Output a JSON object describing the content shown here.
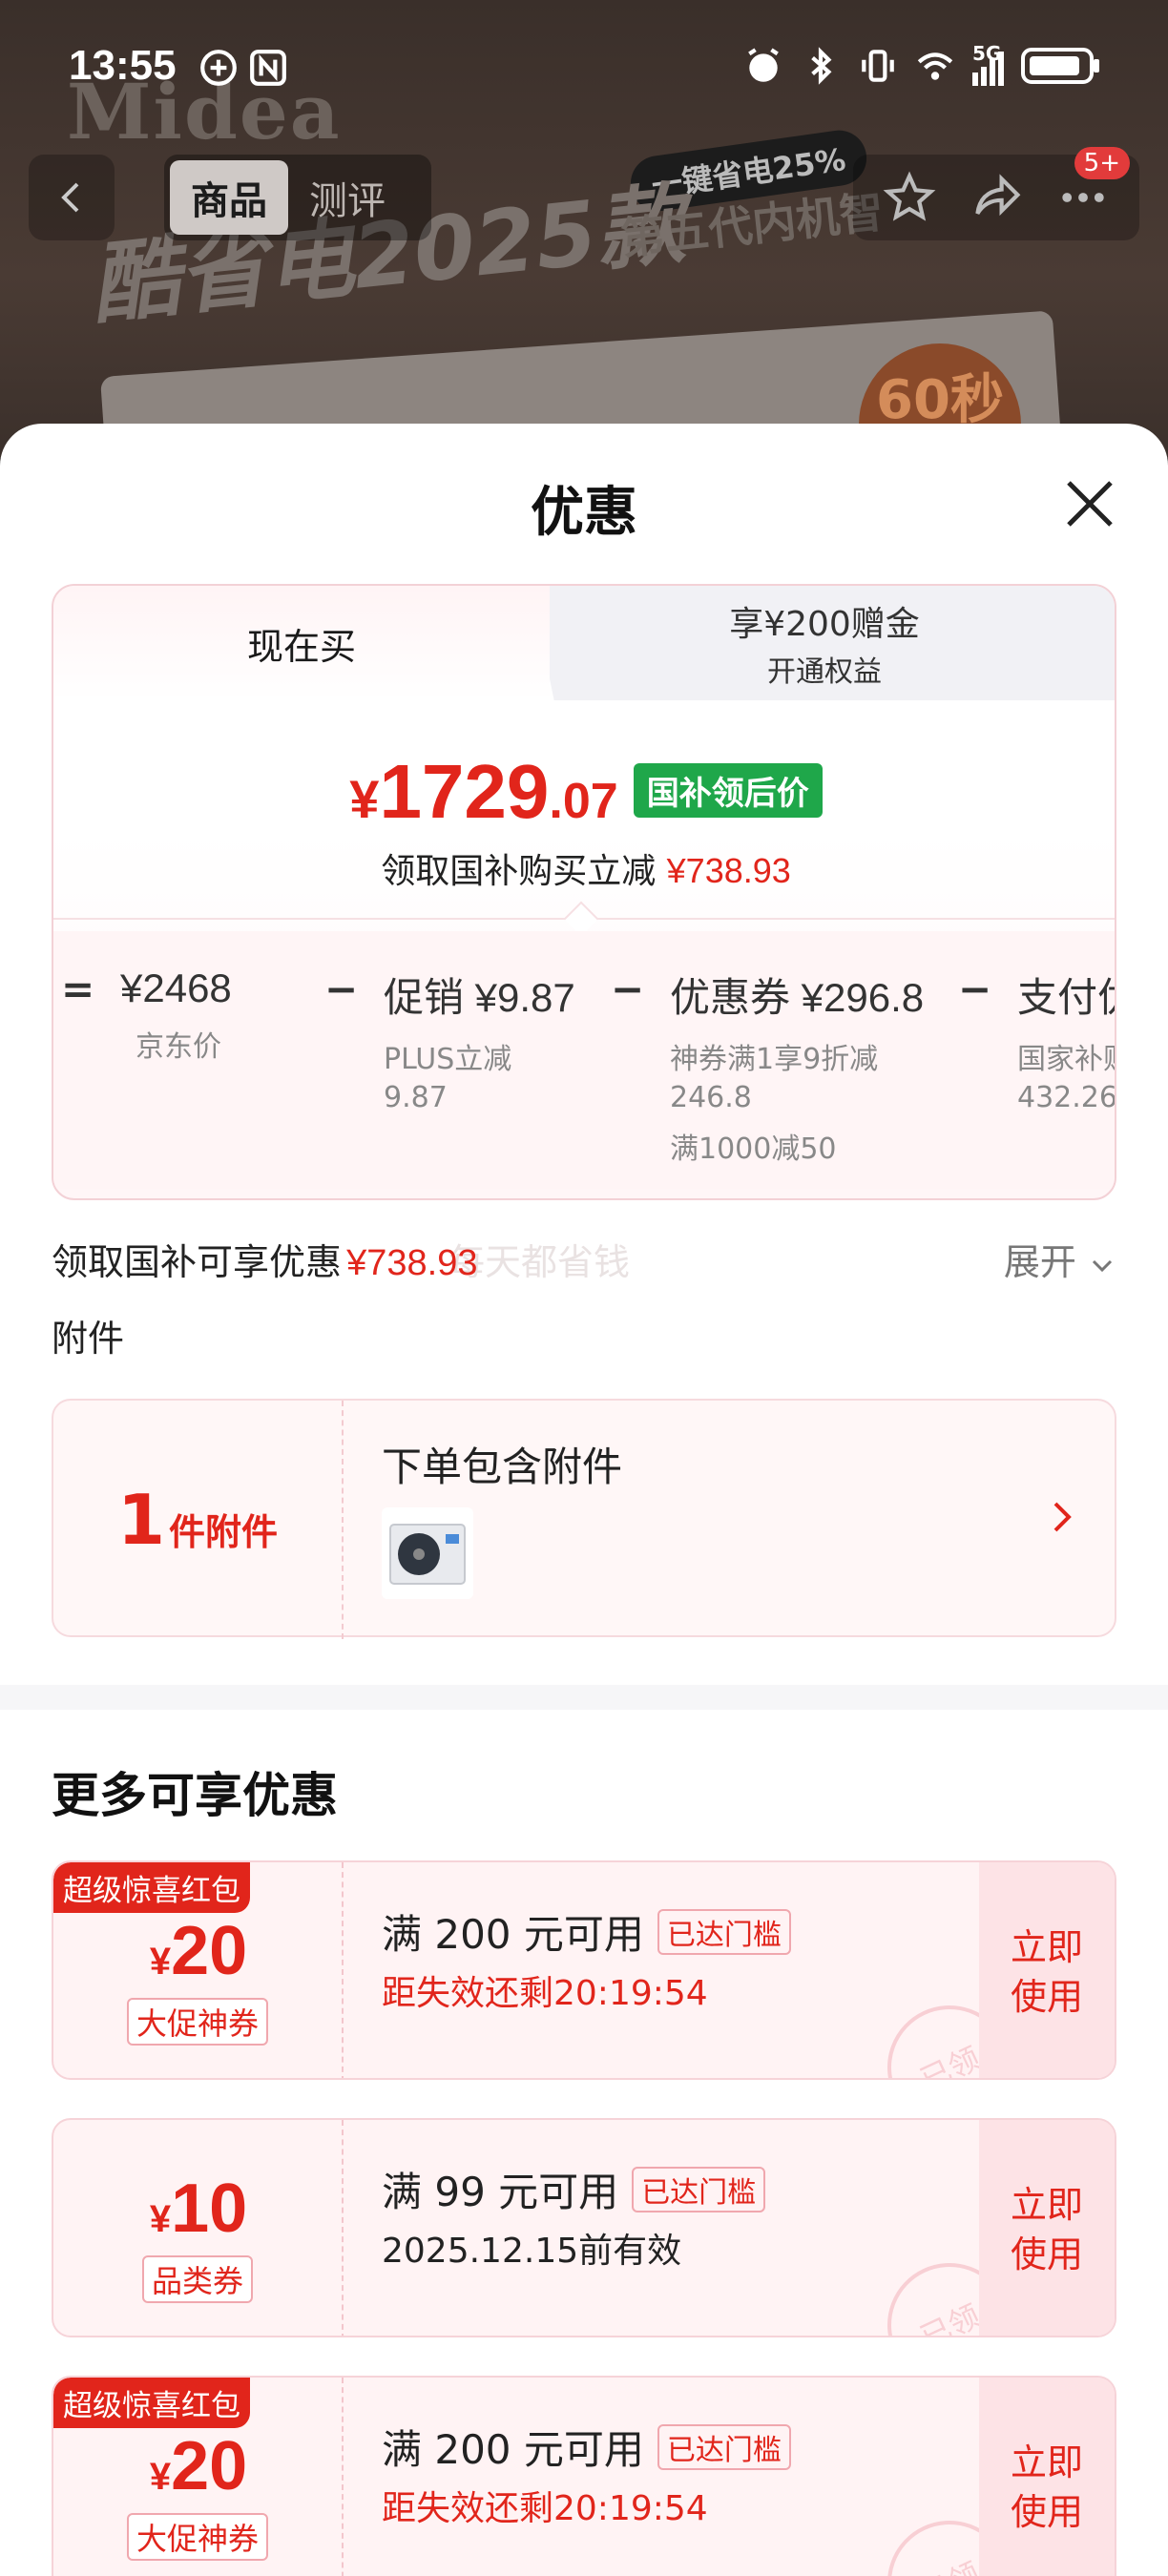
{
  "status_bar": {
    "time": "13:55",
    "signal_label": "5G"
  },
  "background": {
    "brand": "Midea",
    "headline": "酷省电2025款",
    "tagline": "一键省电25%",
    "subline": "第五代内机智",
    "badge": "60秒"
  },
  "nav": {
    "tabs": [
      {
        "label": "商品",
        "active": true
      },
      {
        "label": "测评",
        "active": false
      }
    ],
    "message_badge": "5+"
  },
  "sheet": {
    "title": "优惠",
    "price_card": {
      "tab_now": "现在买",
      "tab_other_line1": "享¥200赠金",
      "tab_other_line2": "开通权益",
      "price_currency": "¥",
      "price_integer": "1729",
      "price_decimal": ".07",
      "price_tag": "国补领后价",
      "sub_text": "领取国补购买立减",
      "sub_amount": "¥738.93",
      "breakdown": [
        {
          "op": "=",
          "head": "¥2468",
          "desc": [
            "京东价"
          ]
        },
        {
          "op": "−",
          "head": "促销 ¥9.87",
          "desc": [
            "PLUS立减",
            "9.87"
          ]
        },
        {
          "op": "−",
          "head": "优惠券 ¥296.8",
          "desc": [
            "神券满1享9折减",
            "246.8",
            "满1000减50"
          ]
        },
        {
          "op": "−",
          "head": "支付优惠",
          "desc": [
            "国家补贴云",
            "432.26"
          ]
        }
      ]
    },
    "saving": {
      "label": "领取国补可享优惠",
      "amount": "¥738.93",
      "expand": "展开",
      "watermark": "每天都省钱"
    },
    "attachment": {
      "section_label": "附件",
      "count": "1",
      "unit": "件附件",
      "title": "下单包含附件"
    },
    "more_title": "更多可享优惠",
    "coupons": [
      {
        "ribbon": "超级惊喜红包",
        "currency": "¥",
        "value": "20",
        "kind": "大促神券",
        "condition": "满 200 元可用",
        "reached": "已达门槛",
        "expiry": "距失效还剩20:19:54",
        "expiry_red": true,
        "use": "立即使用",
        "stamp": "已领"
      },
      {
        "ribbon": "",
        "currency": "¥",
        "value": "10",
        "kind": "品类券",
        "condition": "满 99 元可用",
        "reached": "已达门槛",
        "expiry": "2025.12.15前有效",
        "expiry_red": false,
        "use": "立即使用",
        "stamp": "已领"
      },
      {
        "ribbon": "超级惊喜红包",
        "currency": "¥",
        "value": "20",
        "kind": "大促神券",
        "condition": "满 200 元可用",
        "reached": "已达门槛",
        "expiry": "距失效还剩20:19:54",
        "expiry_red": true,
        "use": "立即使用",
        "stamp": "已领"
      }
    ]
  },
  "colors": {
    "accent_red": "#e1251b",
    "green_tag": "#1fa74a"
  }
}
